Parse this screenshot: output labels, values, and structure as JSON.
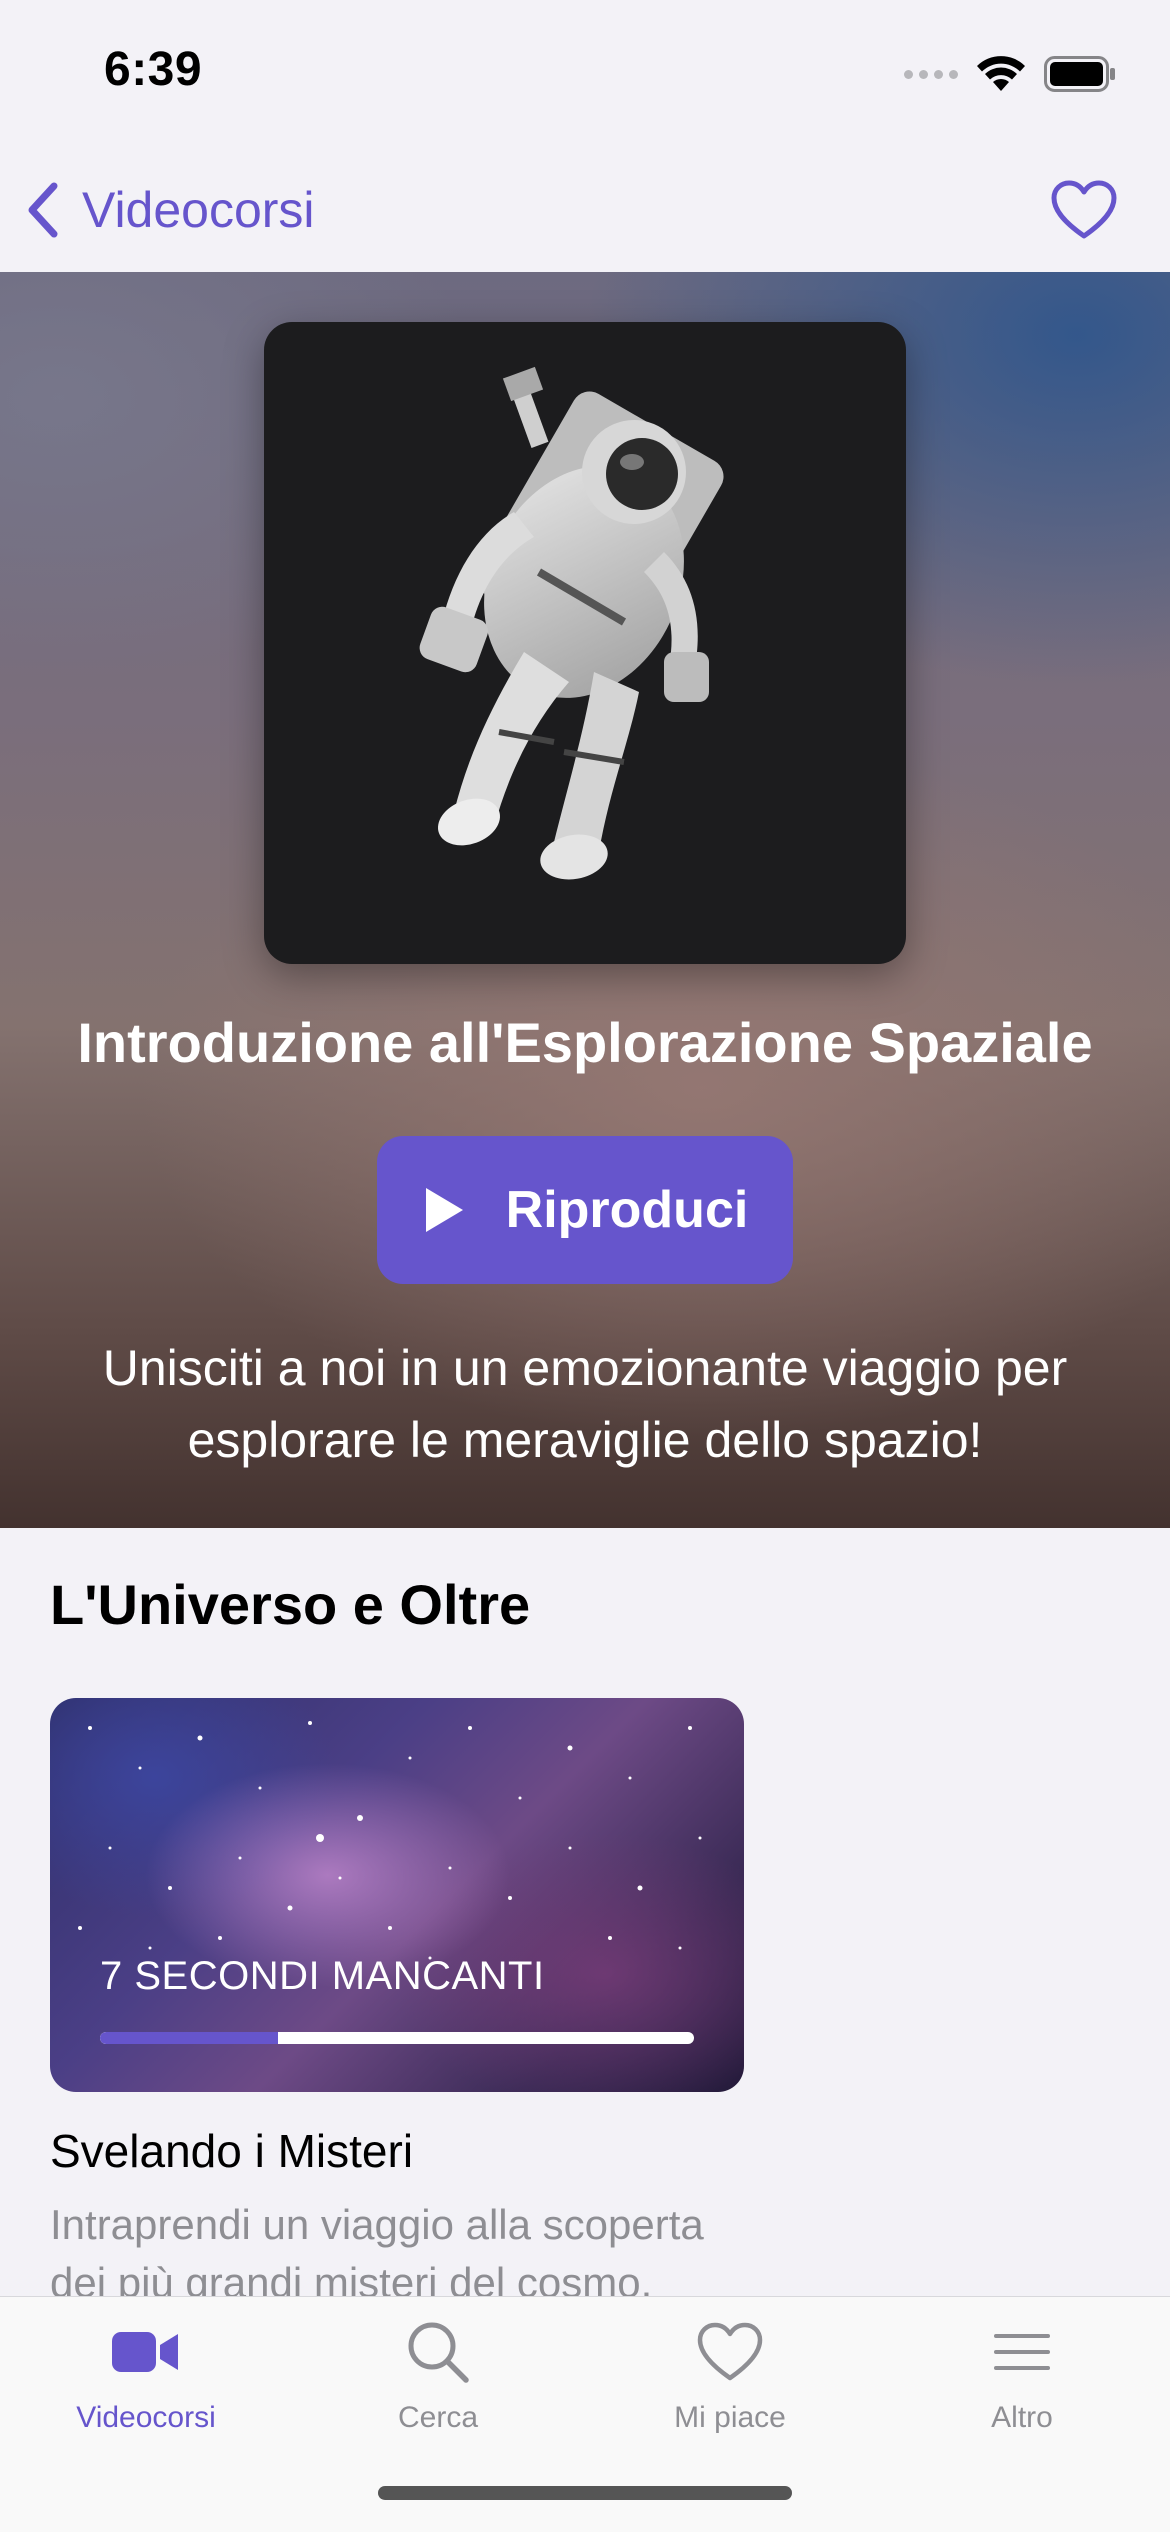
{
  "status_bar": {
    "time": "6:39"
  },
  "nav": {
    "back_label": "Videocorsi",
    "back_icon": "chevron-left-icon",
    "favorite_icon": "heart-outline-icon"
  },
  "hero": {
    "title": "Introduzione all'Esplorazione Spaziale",
    "play_label": "Riproduci",
    "description": "Unisciti a noi in un emozionante viaggio per esplorare le meraviglie dello spazio!"
  },
  "section": {
    "title": "L'Universo e Oltre",
    "course": {
      "remaining": "7 SECONDI MANCANTI",
      "progress": 0.3,
      "title": "Svelando i Misteri",
      "description": "Intraprendi un viaggio alla scoperta dei più grandi misteri del cosmo."
    }
  },
  "tab_bar": {
    "tabs": [
      {
        "label": "Videocorsi",
        "icon": "video-camera-icon",
        "active": true
      },
      {
        "label": "Cerca",
        "icon": "search-icon",
        "active": false
      },
      {
        "label": "Mi piace",
        "icon": "heart-icon",
        "active": false
      },
      {
        "label": "Altro",
        "icon": "menu-icon",
        "active": false
      }
    ]
  },
  "colors": {
    "accent": "#6655cc",
    "background": "#f3f2f7",
    "secondary_text": "#8e8e93"
  }
}
